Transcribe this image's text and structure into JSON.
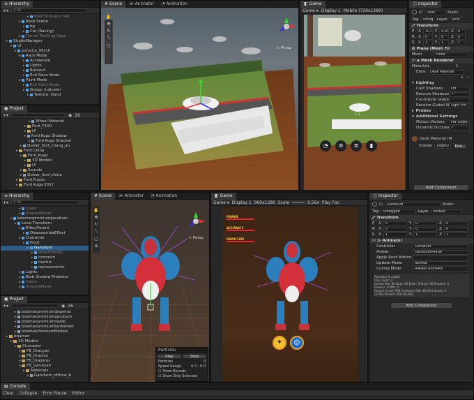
{
  "top": {
    "hierarchy": {
      "tab": "Hierarchy",
      "search_placeholder": "All",
      "items": [
        {
          "label": "Paint Indicator Net",
          "dim": true,
          "indent": 6
        },
        {
          "label": "Race Scene",
          "indent": 4
        },
        {
          "label": "bg",
          "indent": 5
        },
        {
          "label": "Car (Racing)",
          "indent": 5
        },
        {
          "label": "Tunnel Tracking Page",
          "dim": true,
          "indent": 4
        },
        {
          "label": "StudioManager",
          "indent": 1
        },
        {
          "label": "UI",
          "indent": 2
        },
        {
          "label": "porsche_991UI",
          "indent": 3
        },
        {
          "label": "Race Mode",
          "indent": 4
        },
        {
          "label": "Accelerate",
          "indent": 5
        },
        {
          "label": "Lights",
          "indent": 5
        },
        {
          "label": "Burnout",
          "indent": 5
        },
        {
          "label": "Exit Race Mode",
          "indent": 5
        },
        {
          "label": "Paint Mode",
          "indent": 4
        },
        {
          "label": "Exit Paint Mode",
          "dim": true,
          "indent": 5
        },
        {
          "label": "Group: Indicator",
          "indent": 5
        },
        {
          "label": "Texture: Hand",
          "indent": 6
        }
      ]
    },
    "project": {
      "tab": "Project",
      "count": "26",
      "items": [
        {
          "label": "Wheel Material",
          "indent": 4,
          "type": "file"
        },
        {
          "label": "Font_F150",
          "indent": 3,
          "type": "folder"
        },
        {
          "label": "UI",
          "indent": 3,
          "type": "folder"
        },
        {
          "label": "Ford Kuga Shadow",
          "indent": 3,
          "type": "file"
        },
        {
          "label": "Ford Kuga Shadow",
          "indent": 4,
          "type": "file"
        },
        {
          "label": "Quiver_font_chang_an",
          "indent": 2,
          "type": "file"
        },
        {
          "label": "Font China",
          "indent": 1,
          "type": "folder"
        },
        {
          "label": "Ford_Kuga",
          "indent": 2,
          "type": "folder"
        },
        {
          "label": "3D Models",
          "indent": 3,
          "type": "folder"
        },
        {
          "label": "UI",
          "indent": 3,
          "type": "folder"
        },
        {
          "label": "Sounds",
          "indent": 2,
          "type": "folder"
        },
        {
          "label": "Quiver_ford_china",
          "indent": 2,
          "type": "file"
        },
        {
          "label": "Ford Fusion",
          "indent": 1,
          "type": "folder"
        },
        {
          "label": "Ford Kuga 2017",
          "indent": 1,
          "type": "folder"
        }
      ]
    },
    "scene": {
      "tabs": [
        "Scene",
        "Animator",
        "Animation"
      ],
      "persp": "< Persp"
    },
    "game": {
      "tab": "Game",
      "display": "Display 1",
      "aspect": "Mobile (720x1280)"
    },
    "inspector": {
      "tab": "Inspector",
      "object": "Desk",
      "static": "Static",
      "tag": "Untag",
      "layer": "Defa",
      "transform": {
        "title": "Transform",
        "p": [
          "-8.7307",
          "0.04292",
          "0"
        ],
        "r": [
          "0",
          "0",
          "0"
        ],
        "s": [
          "1",
          "1",
          "1"
        ]
      },
      "mesh_filter": {
        "title": "Plane (Mesh Fil",
        "mesh_label": "Mesh",
        "mesh_value": "Plane"
      },
      "mesh_renderer": {
        "title": "Mesh Renderer"
      },
      "materials": {
        "label": "Materials",
        "count": "1",
        "elem_label": "Elem",
        "elem_value": "Desk Material"
      },
      "lighting": {
        "title": "Lighting",
        "rows": [
          {
            "label": "Cast Shadows",
            "value": "Off"
          },
          {
            "label": "Receive Shadows",
            "value": "✓"
          },
          {
            "label": "Contribute Global",
            "value": ""
          },
          {
            "label": "Receive Global Illu",
            "value": "Light Pro"
          }
        ]
      },
      "probes": "Probes",
      "additional": {
        "title": "Additional Settings",
        "rows": [
          {
            "label": "Motion Vectors",
            "value": "Per Objec"
          },
          {
            "label": "Dynamic Occlusio",
            "value": "✓"
          }
        ]
      },
      "material_asset": {
        "name": "Desk Material (M",
        "shader_label": "Shader",
        "shader_value": "Legacy",
        "edit": "Edit..."
      },
      "add_component": "Add Component"
    }
  },
  "bottom": {
    "hierarchy": {
      "tab": "Hierarchy",
      "search_placeholder": "All",
      "items": [
        {
          "label": "Cover",
          "dim": true,
          "indent": 4
        },
        {
          "label": "ShadowPlane",
          "dim": true,
          "indent": 4
        },
        {
          "label": "bdamanpremiumgarubum",
          "indent": 2
        },
        {
          "label": "Local Transform",
          "indent": 3
        },
        {
          "label": "EffectParent",
          "indent": 4
        },
        {
          "label": "DisassembleEffect",
          "indent": 5
        },
        {
          "label": "Character",
          "indent": 4
        },
        {
          "label": "Pivot",
          "indent": 5
        },
        {
          "label": "Garubum",
          "indent": 6,
          "selected": true
        },
        {
          "label": "attachments",
          "dim": true,
          "indent": 7
        },
        {
          "label": "common",
          "indent": 7
        },
        {
          "label": "marble",
          "indent": 7
        },
        {
          "label": "replacements",
          "indent": 7
        },
        {
          "label": "Lights",
          "indent": 4
        },
        {
          "label": "Blob Shadow Projector",
          "indent": 4
        },
        {
          "label": "Camo",
          "dim": true,
          "indent": 4
        },
        {
          "label": "ShadowPlane",
          "dim": true,
          "indent": 4
        }
      ]
    },
    "project": {
      "tab": "Project",
      "count": "26",
      "items": [
        {
          "label": "bdamanpremiumdrazeros",
          "indent": 3,
          "type": "file"
        },
        {
          "label": "bdamanpremiumgarubum",
          "indent": 3,
          "type": "file"
        },
        {
          "label": "bdamanpremiumrayde",
          "indent": 3,
          "type": "file"
        },
        {
          "label": "bdamanpremiumtanksheet",
          "indent": 3,
          "type": "file"
        },
        {
          "label": "bdamanPremiumModels",
          "indent": 3,
          "type": "file"
        },
        {
          "label": "bdaman",
          "indent": 1,
          "type": "folder"
        },
        {
          "label": "3D Models",
          "indent": 2,
          "type": "folder"
        },
        {
          "label": "Character",
          "indent": 3,
          "type": "folder"
        },
        {
          "label": "FB_Dracyan",
          "indent": 4,
          "type": "folder"
        },
        {
          "label": "FB_Dravisa",
          "indent": 4,
          "type": "folder"
        },
        {
          "label": "FB_Drazeros",
          "indent": 4,
          "type": "folder"
        },
        {
          "label": "FB_Garubum",
          "indent": 4,
          "type": "folder"
        },
        {
          "label": "Materials",
          "indent": 5,
          "type": "folder"
        },
        {
          "label": "Garubum_official_b",
          "indent": 6,
          "type": "file"
        }
      ]
    },
    "scene": {
      "tabs": [
        "Scene",
        "Animator",
        "Animation"
      ],
      "persp": "< Persp"
    },
    "particles": {
      "title": "Particles",
      "play": "Play",
      "stop": "Stop",
      "rows": [
        {
          "label": "Particles",
          "value": "0"
        },
        {
          "label": "Speed Range",
          "value": "0.0 - 0.0"
        }
      ],
      "checks": [
        "Show Bounds",
        "Show Only Selected"
      ]
    },
    "game": {
      "tab": "Game",
      "view_label": "Game",
      "display": "Display 1",
      "aspect": "960x1280",
      "scale_label": "Scale",
      "scale_value": "0.56x",
      "play_focused": "Play Foc",
      "hud": [
        "POWER",
        "ACCURACY",
        "RAPID FIRE"
      ]
    },
    "inspector": {
      "tab": "Inspector",
      "object": "Garubum",
      "static": "Static",
      "tag_label": "Tag",
      "tag": "Untagged",
      "layer_label": "Layer",
      "layer": "Default",
      "transform": {
        "title": "Transform",
        "p": [
          "0",
          "0",
          "0"
        ],
        "r": [
          "0",
          "0",
          "0"
        ],
        "s": [
          "1",
          "1",
          "1"
        ]
      },
      "animator": {
        "title": "Animator",
        "rows": [
          {
            "label": "Controller",
            "value": "Garubum"
          },
          {
            "label": "Avatar",
            "value": "GarubumAvatar"
          },
          {
            "label": "Apply Root Motion",
            "value": ""
          },
          {
            "label": "Update Mode",
            "value": "Normal"
          },
          {
            "label": "Culling Mode",
            "value": "Always Animate"
          }
        ],
        "info": [
          "Animator is visible",
          "Clip Count: 3",
          "Curves Pos: 60 Quat: 60 Euler: 0 Scale: 96 Muscles: 0",
          "Generic: 0 PPtr: 0",
          "Curves Count: 996 Constant: 666 (69.2%) Dense: 0",
          "(0.0%) Stream: 300 (30.8%)"
        ]
      },
      "add_component": "Add Component"
    },
    "console": {
      "tab": "Console",
      "buttons": [
        "Clear",
        "Collapse",
        "Error Pause",
        "Editor"
      ]
    }
  }
}
